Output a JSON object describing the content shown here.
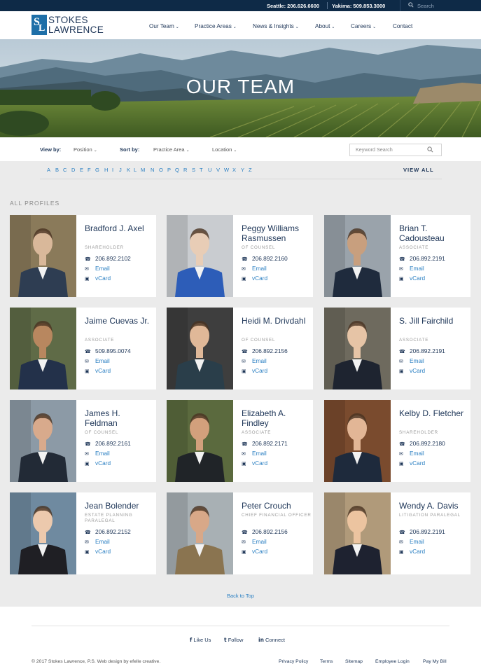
{
  "topbar": {
    "seattle": "Seattle: 206.626.6600",
    "yakima": "Yakima: 509.853.3000",
    "search_placeholder": "Search"
  },
  "logo": {
    "line1": "STOKES",
    "line2": "LAWRENCE"
  },
  "nav": [
    {
      "label": "Our Team",
      "dropdown": true
    },
    {
      "label": "Practice Areas",
      "dropdown": true
    },
    {
      "label": "News & Insights",
      "dropdown": true
    },
    {
      "label": "About",
      "dropdown": true
    },
    {
      "label": "Careers",
      "dropdown": true
    },
    {
      "label": "Contact",
      "dropdown": false
    }
  ],
  "hero": {
    "title": "OUR TEAM"
  },
  "filters": {
    "view_by_label": "View by:",
    "position": "Position",
    "sort_by_label": "Sort by:",
    "practice_area": "Practice Area",
    "location": "Location",
    "keyword_placeholder": "Keyword Search"
  },
  "alphabet": [
    "A",
    "B",
    "C",
    "D",
    "E",
    "F",
    "G",
    "H",
    "I",
    "J",
    "K",
    "L",
    "M",
    "N",
    "O",
    "P",
    "Q",
    "R",
    "S",
    "T",
    "U",
    "V",
    "W",
    "X",
    "Y",
    "Z"
  ],
  "view_all": "VIEW ALL",
  "section_label": "ALL PROFILES",
  "profiles": [
    {
      "name": "Bradford J. Axel",
      "title": "SHAREHOLDER",
      "phone": "206.892.2102",
      "email": "Email",
      "vcard": "vCard"
    },
    {
      "name": "Peggy Williams Rasmussen",
      "title": "OF COUNSEL",
      "phone": "206.892.2160",
      "email": "Email",
      "vcard": "vCard"
    },
    {
      "name": "Brian T. Cadousteau",
      "title": "ASSOCIATE",
      "phone": "206.892.2191",
      "email": "Email",
      "vcard": "vCard"
    },
    {
      "name": "Jaime Cuevas Jr.",
      "title": "ASSOCIATE",
      "phone": "509.895.0074",
      "email": "Email",
      "vcard": "vCard"
    },
    {
      "name": "Heidi M. Drivdahl",
      "title": "OF COUNSEL",
      "phone": "206.892.2156",
      "email": "Email",
      "vcard": "vCard"
    },
    {
      "name": "S. Jill Fairchild",
      "title": "ASSOCIATE",
      "phone": "206.892.2191",
      "email": "Email",
      "vcard": "vCard"
    },
    {
      "name": "James H. Feldman",
      "title": "OF COUNSEL",
      "phone": "206.892.2161",
      "email": "Email",
      "vcard": "vCard"
    },
    {
      "name": "Elizabeth A. Findley",
      "title": "ASSOCIATE",
      "phone": "206.892.2171",
      "email": "Email",
      "vcard": "vCard"
    },
    {
      "name": "Kelby D. Fletcher",
      "title": "SHAREHOLDER",
      "phone": "206.892.2180",
      "email": "Email",
      "vcard": "vCard"
    },
    {
      "name": "Jean Bolender",
      "title": "ESTATE PLANNING PARALEGAL",
      "phone": "206.892.2152",
      "email": "Email",
      "vcard": "vCard"
    },
    {
      "name": "Peter Crouch",
      "title": "CHIEF FINANCIAL OFFICER",
      "phone": "206.892.2156",
      "email": "Email",
      "vcard": "vCard"
    },
    {
      "name": "Wendy A. Davis",
      "title": "LITIGATION PARALEGAL",
      "phone": "206.892.2191",
      "email": "Email",
      "vcard": "vCard"
    }
  ],
  "back_to_top": "Back to Top",
  "footer": {
    "like": "Like Us",
    "follow": "Follow",
    "connect": "Connect",
    "copyright": "© 2017 Stokes Lawrence, P.S. Web design by efelle creative.",
    "links": [
      "Privacy Policy",
      "Terms",
      "Sitemap",
      "Employee Login",
      "Pay My Bill"
    ]
  },
  "colors": {
    "navy": "#1d3557",
    "accent_blue": "#2a7fc2",
    "topbar": "#0e2a47"
  }
}
